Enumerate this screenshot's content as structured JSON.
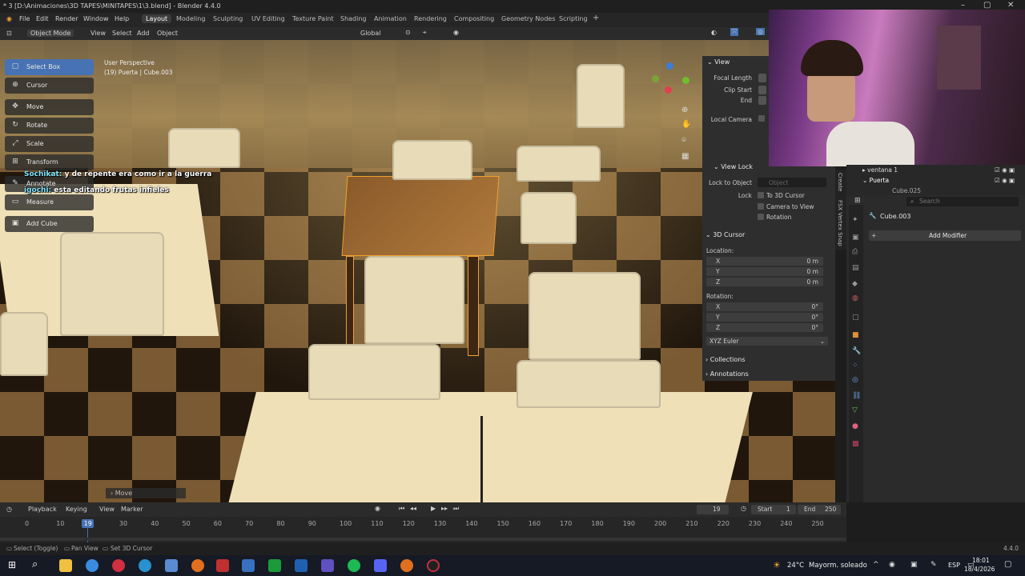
{
  "window": {
    "title": "* 3 [D:\\Animaciones\\3D TAPES\\MINITAPES\\1\\3.blend] - Blender 4.4.0"
  },
  "menu": [
    "File",
    "Edit",
    "Render",
    "Window",
    "Help"
  ],
  "workspaces": [
    "Layout",
    "Modeling",
    "Sculpting",
    "UV Editing",
    "Texture Paint",
    "Shading",
    "Animation",
    "Rendering",
    "Compositing",
    "Geometry Nodes",
    "Scripting"
  ],
  "header": {
    "mode": "Object Mode",
    "view": "View",
    "select": "Select",
    "add": "Add",
    "object": "Object",
    "orientation": "Global"
  },
  "viewport": {
    "perspective": "User Perspective",
    "object_info": "(19) Puerta | Cube.003",
    "last_op": "Move"
  },
  "tools": [
    {
      "label": "Select Box",
      "icon": "▢"
    },
    {
      "label": "Cursor",
      "icon": "⊕"
    },
    {
      "label": "Move",
      "icon": "✥"
    },
    {
      "label": "Rotate",
      "icon": "↻"
    },
    {
      "label": "Scale",
      "icon": "⤢"
    },
    {
      "label": "Transform",
      "icon": "⊞"
    },
    {
      "label": "Annotate",
      "icon": "✎"
    },
    {
      "label": "Measure",
      "icon": "▭"
    },
    {
      "label": "Add Cube",
      "icon": "▣"
    }
  ],
  "chat": [
    {
      "user": "Sochikat:",
      "text": "y de repente era como ir a la guerra"
    },
    {
      "user": "igochi:",
      "text": "esta editando frutas infieles"
    }
  ],
  "npanel": {
    "view_title": "View",
    "focal_length": "Focal Length",
    "clip_start": "Clip Start",
    "end": "End",
    "local_camera": "Local Camera",
    "view_lock": "View Lock",
    "lock_to_object": "Lock to Object",
    "object_placeholder": "Object",
    "lock": "Lock",
    "to_3d_cursor": "To 3D Cursor",
    "camera_to_view": "Camera to View",
    "rotation_chk": "Rotation",
    "cursor_title": "3D Cursor",
    "location": "Location:",
    "rotation": "Rotation:",
    "axes": [
      "X",
      "Y",
      "Z"
    ],
    "loc_vals": [
      "0 m",
      "0 m",
      "0 m"
    ],
    "rot_vals": [
      "0°",
      "0°",
      "0°"
    ],
    "euler": "XYZ Euler",
    "collections": "Collections",
    "annotations": "Annotations"
  },
  "side_tabs": [
    "Create",
    "FSX Vertex Snap"
  ],
  "outliner": {
    "items": [
      "ventana 1",
      "Puerta",
      "Cube.025"
    ]
  },
  "properties": {
    "search_placeholder": "Search",
    "object": "Cube.003",
    "add_modifier": "Add Modifier"
  },
  "timeline": {
    "playback": "Playback",
    "keying": "Keying",
    "view": "View",
    "marker": "Marker",
    "current": "19",
    "start_label": "Start",
    "start": "1",
    "end_label": "End",
    "end": "250",
    "ticks": [
      "0",
      "10",
      "19",
      "30",
      "40",
      "50",
      "60",
      "70",
      "80",
      "90",
      "100",
      "110",
      "120",
      "130",
      "140",
      "150",
      "160",
      "170",
      "180",
      "190",
      "200",
      "210",
      "220",
      "230",
      "240",
      "250"
    ]
  },
  "status": {
    "select": "Select (Toggle)",
    "pan": "Pan View",
    "cursor": "Set 3D Cursor",
    "version": "4.4.0"
  },
  "taskbar": {
    "weather": "24°C",
    "weather_desc": "Mayorm. soleado",
    "lang": "ESP",
    "time": "18:01",
    "date": "18/4/2026"
  }
}
